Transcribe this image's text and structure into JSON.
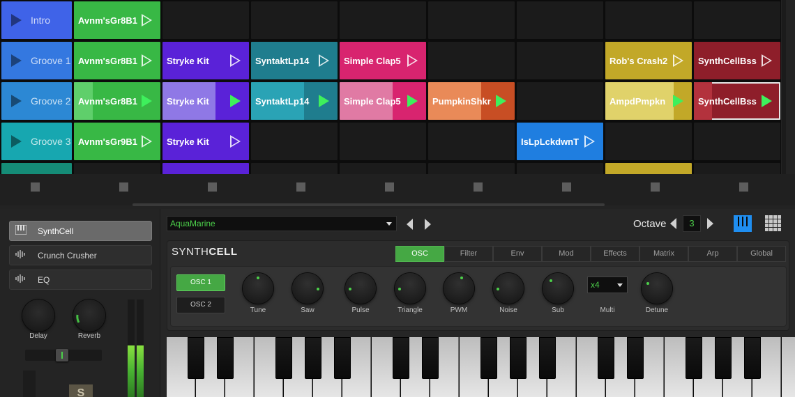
{
  "clip_grid": {
    "rows": [
      {
        "scene": "Intro",
        "scene_color": "#3f63e8",
        "clips": [
          {
            "label": "Avnm'sGr8B1",
            "color": "#38b845",
            "state": "idle"
          },
          null,
          null,
          null,
          null,
          null,
          null,
          null
        ]
      },
      {
        "scene": "Groove 1",
        "scene_color": "#3478e0",
        "clips": [
          {
            "label": "Avnm'sGr8B1",
            "color": "#38b845",
            "state": "idle"
          },
          {
            "label": "Stryke Kit",
            "color": "#5a22d8",
            "state": "idle"
          },
          {
            "label": "SyntaktLp14",
            "color": "#1f7d8e",
            "state": "idle"
          },
          {
            "label": "Simple Clap5",
            "color": "#d8246f",
            "state": "idle"
          },
          null,
          null,
          {
            "label": "Rob's Crash2",
            "color": "#c2a828",
            "state": "idle"
          },
          {
            "label": "SynthCellBss",
            "color": "#8e1e2a",
            "state": "idle"
          }
        ]
      },
      {
        "scene": "Groove 2",
        "scene_color": "#2c88d4",
        "clips": [
          {
            "label": "Avnm'sGr8B1",
            "color": "#38b845",
            "fill": "#5fcf6b",
            "progress": 0.22,
            "state": "playing"
          },
          {
            "label": "Stryke Kit",
            "color": "#5a22d8",
            "fill": "#8f78e6",
            "progress": 0.61,
            "state": "playing"
          },
          {
            "label": "SyntaktLp14",
            "color": "#1f7d8e",
            "fill": "#2aa3b5",
            "progress": 0.61,
            "state": "playing"
          },
          {
            "label": "Simple Clap5",
            "color": "#d8246f",
            "fill": "#e07aa4",
            "progress": 0.61,
            "state": "playing"
          },
          {
            "label": "PumpkinShkr",
            "color": "#c84e24",
            "fill": "#e98a58",
            "progress": 0.61,
            "state": "playing"
          },
          null,
          {
            "label": "AmpdPmpkn",
            "color": "#c2a828",
            "fill": "#e0d26a",
            "progress": 0.79,
            "state": "playing"
          },
          {
            "label": "SynthCellBss",
            "color": "#8e1e2a",
            "fill": "#b3323d",
            "progress": 0.21,
            "state": "playing",
            "selected": true
          }
        ]
      },
      {
        "scene": "Groove 3",
        "scene_color": "#17a7b0",
        "clips": [
          {
            "label": "Avnm'sGr9B1",
            "color": "#38b845",
            "state": "idle"
          },
          {
            "label": "Stryke Kit",
            "color": "#5a22d8",
            "state": "idle"
          },
          null,
          null,
          null,
          {
            "label": "IsLpLckdwnT",
            "color": "#1f7ee0",
            "state": "idle"
          },
          null,
          null
        ]
      },
      {
        "scene": "",
        "scene_color": "#158c77",
        "clips": [
          null,
          {
            "label": "",
            "color": "#5a22d8",
            "state": "idle"
          },
          null,
          null,
          null,
          null,
          {
            "label": "",
            "color": "#c2a828",
            "state": "idle"
          },
          null
        ]
      }
    ]
  },
  "devices": [
    {
      "name": "SynthCell",
      "icon": "piano-icon",
      "selected": true
    },
    {
      "name": "Crunch Crusher",
      "icon": "waveform-icon",
      "selected": false
    },
    {
      "name": "EQ",
      "icon": "waveform-icon",
      "selected": false
    }
  ],
  "sends": [
    {
      "label": "Delay",
      "value": 0.0
    },
    {
      "label": "Reverb",
      "value": 0.3
    }
  ],
  "meters": {
    "left": 0.53,
    "right": 0.53
  },
  "mute_label": "S",
  "preset": {
    "name": "AquaMarine"
  },
  "octave": {
    "label": "Octave",
    "value": "3"
  },
  "synth": {
    "title_light": "SYNTH",
    "title_bold": "CELL",
    "tabs": [
      "OSC",
      "Filter",
      "Env",
      "Mod",
      "Effects",
      "Matrix",
      "Arp",
      "Global"
    ],
    "active_tab": "OSC",
    "osc_buttons": [
      {
        "label": "OSC 1",
        "active": true
      },
      {
        "label": "OSC 2",
        "active": false
      }
    ],
    "knobs": [
      {
        "label": "Tune",
        "value": 0.5
      },
      {
        "label": "Saw",
        "value": 0.85
      },
      {
        "label": "Pulse",
        "value": 0.15
      },
      {
        "label": "Triangle",
        "value": 0.15
      },
      {
        "label": "PWM",
        "value": 0.55
      },
      {
        "label": "Noise",
        "value": 0.15
      },
      {
        "label": "Sub",
        "value": 0.35
      },
      {
        "label": "Detune",
        "value": 0.27
      }
    ],
    "multi": {
      "label": "Multi",
      "value": "x4"
    }
  },
  "colors": {
    "accent": "#45a844",
    "value_text": "#4cd04a",
    "piano_icon": "#1f8ef0"
  }
}
